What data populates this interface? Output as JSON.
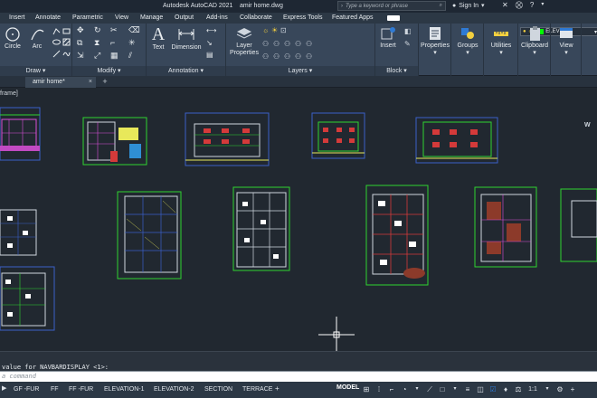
{
  "titlebar": {
    "app_title": "Autodesk AutoCAD 2021",
    "file_name": "amir home.dwg",
    "search_placeholder": "Type a keyword or phrase",
    "sign_in": "Sign In"
  },
  "menu": {
    "items": [
      "Insert",
      "Annotate",
      "Parametric",
      "View",
      "Manage",
      "Output",
      "Add-ins",
      "Collaborate",
      "Express Tools",
      "Featured Apps"
    ]
  },
  "ribbon": {
    "draw": {
      "circle": "Circle",
      "arc": "Arc",
      "label": "Draw"
    },
    "modify": {
      "label": "Modify"
    },
    "annotation": {
      "text": "Text",
      "dimension": "Dimension",
      "label": "Annotation"
    },
    "layers": {
      "layer_properties": "Layer\nProperties",
      "layer_name": "ELEV",
      "label": "Layers"
    },
    "block": {
      "insert": "Insert",
      "label": "Block"
    },
    "properties": "Properties",
    "groups": "Groups",
    "utilities": "Utilities",
    "clipboard": "Clipboard",
    "view": "View"
  },
  "doc_tabs": {
    "active": "amir home*"
  },
  "canvas": {
    "view_label": "frame]",
    "navcube_text": "W"
  },
  "command": {
    "history": " value for NAVBARDISPLAY <1>:",
    "placeholder": "a command"
  },
  "status": {
    "layout_tabs": [
      "GF -FUR",
      "FF",
      "FF -FUR",
      "ELEVATION-1",
      "ELEVATION-2",
      "SECTION",
      "TERRACE"
    ],
    "model": "MODEL",
    "scale": "1:1"
  },
  "colors": {
    "accent": "#2f7ad4",
    "layer_color": "#00ff00"
  }
}
